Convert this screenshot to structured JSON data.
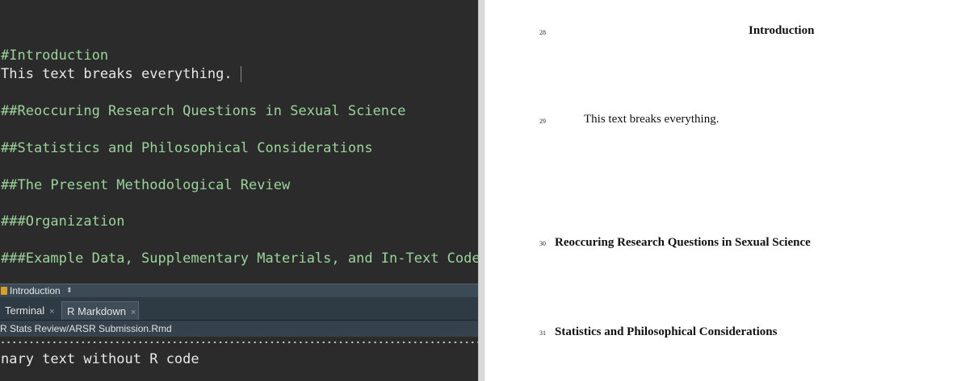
{
  "editor": {
    "lines": [
      "#Introduction",
      "This text breaks everything.",
      "##Reoccuring Research Questions in Sexual Science",
      "##Statistics and Philosophical Considerations",
      "##The Present Methodological Review",
      "###Organization",
      "###Example Data, Supplementary Materials, and In-Text Code"
    ]
  },
  "outline": {
    "section": "Introduction",
    "chevron": "⬍"
  },
  "console_tabs": {
    "terminal": "Terminal",
    "rmarkdown": "R Markdown",
    "close": "×"
  },
  "path": "R Stats Review/ARSR Submission.Rmd",
  "console": {
    "output": "nary text without R code"
  },
  "preview": {
    "items": [
      {
        "line_no": "28",
        "text": "Introduction"
      },
      {
        "line_no": "29",
        "text": "This text breaks everything."
      },
      {
        "line_no": "30",
        "text": "Reoccuring Research Questions in Sexual Science"
      },
      {
        "line_no": "31",
        "text": "Statistics and Philosophical Considerations"
      }
    ]
  },
  "colors": {
    "editor_bg": "#2b2b2b",
    "heading": "#9bd39b",
    "tab_bar": "#2e3a44"
  }
}
